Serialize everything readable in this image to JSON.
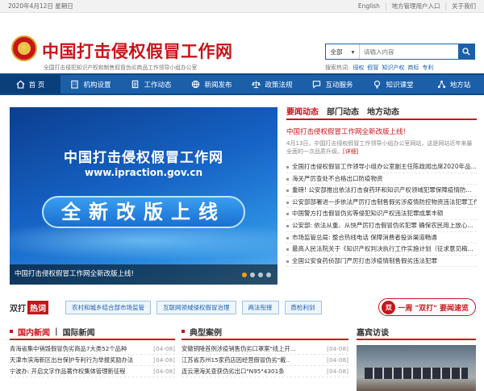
{
  "topbar": {
    "date": "2020年4月12日 星期日",
    "links": [
      "English",
      "地方管理用户入口",
      "关于我们"
    ]
  },
  "header": {
    "title": "中国打击侵权假冒工作网",
    "subtitle": "全国打击侵犯知识产权和制售假冒伪劣商品工作领导小组办公室"
  },
  "search": {
    "scope": "全部",
    "placeholder": "请输入内容",
    "hot_label": "搜索热词:",
    "hot_words": [
      "侵权",
      "假冒",
      "知识产权",
      "商标",
      "专利"
    ]
  },
  "nav": [
    {
      "label": "首 页",
      "icon": "home-icon"
    },
    {
      "label": "机构设置",
      "icon": "building-icon"
    },
    {
      "label": "工作动态",
      "icon": "document-icon"
    },
    {
      "label": "新闻发布",
      "icon": "globe-icon"
    },
    {
      "label": "政策法规",
      "icon": "scales-icon"
    },
    {
      "label": "互动服务",
      "icon": "chat-icon"
    },
    {
      "label": "知识课堂",
      "icon": "bulb-icon"
    },
    {
      "label": "地方站",
      "icon": "network-icon"
    }
  ],
  "banner": {
    "line1": "中国打击侵权假冒工作网",
    "line2": "www.ipraction.gov.cn",
    "line3": "全新改版上线",
    "caption": "中国打击侵权假冒工作网全新改版上线!",
    "slides": 4,
    "active": 0
  },
  "news": {
    "tabs": [
      "要闻动态",
      "部门动态",
      "地方动态"
    ],
    "headline": "中国打击侵权假冒工作网全新改版上线!",
    "summary": "4月13日，中国打击侵权假冒工作领导小组办公室网站，这是网站近年来最全面的一次品质升级。",
    "more": "[详细]",
    "items": [
      "全国打击侵权假冒工作领导小组办公室副主任陈政闻出席2020年品...",
      "海关严厉查处不合格出口防疫物资",
      "重磅! 公安部推出依法打击食药环和知识产权领域犯罪保障疫情防...",
      "公安部部署进一步依法严厉打击制售假劣涉疫情防控物资违法犯罪工作",
      "中国警方打击假冒伪劣等侵犯知识产权违法犯罪成果丰硕",
      "公安部: 依法从重、从快严厉打击假冒伪劣犯罪 确保农民用上放心...",
      "市场监管总局: 整合热线电话 保障消费者投诉渠道畅通",
      "最高人民法院关于《知识产权判决执行工作实施计划（征求意见稿...",
      "全国公安食药侦部门严厉打击涉疫情制售假劣违法犯罪"
    ]
  },
  "hotwords": {
    "label1": "双打",
    "label2": "热词",
    "tags": [
      "农村和城乡结合部市场监管",
      "互联网领域侵权假冒治理",
      "两法衔接",
      "质检利剑"
    ]
  },
  "speed": {
    "badge": "双",
    "text": "一周 \"双打\" 要闻速览"
  },
  "col_news": {
    "tabs": [
      "国内新闻",
      "国际新闻"
    ],
    "items": [
      {
        "text": "青海省集中销毁假冒伪劣商品7大类52个品种",
        "date": "[04-08]"
      },
      {
        "text": "天津市滨海新区出台保护专利行为举报奖励办法",
        "date": "[04-08]"
      },
      {
        "text": "宁波办: 开启文字作品著作权集体管理新征程",
        "date": "[04-08]"
      }
    ]
  },
  "col_cases": {
    "title": "典型案例",
    "items": [
      {
        "text": "安徽铜陵首例涉疫销售伪劣口罩案\"线上开...",
        "date": "[04-08]"
      },
      {
        "text": "江苏省苏州15家药店因经营假冒伪劣\"戴..",
        "date": "[04-08]"
      },
      {
        "text": "连云港海关查获伪劣出口\"N95\"4301条",
        "date": "[04-08]"
      }
    ]
  },
  "col_visit": {
    "title": "嘉宾访谈"
  }
}
